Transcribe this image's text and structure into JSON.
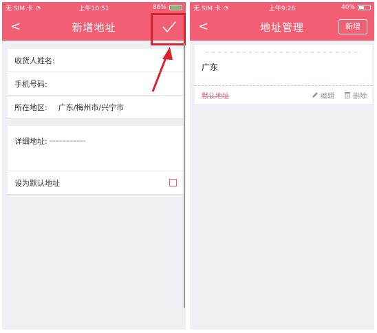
{
  "left": {
    "status": {
      "carrier": "无 SIM 卡",
      "time": "上午10:51",
      "battery": "86%"
    },
    "nav": {
      "back": "<",
      "title": "新增地址"
    },
    "form": {
      "name_label": "收货人姓名:",
      "phone_label": "手机号码:",
      "region_label": "所在地区:",
      "region_value": "广东/梅州市/兴宁市",
      "detail_label": "详细地址:",
      "default_label": "设为默认地址"
    }
  },
  "right": {
    "status": {
      "carrier": "无 SIM 卡",
      "time": "上午9:26",
      "battery": "40%"
    },
    "nav": {
      "back": "<",
      "title": "地址管理",
      "new_button": "新增"
    },
    "card": {
      "region": "广东",
      "default_label": "默认地址",
      "edit_label": "编辑",
      "delete_label": "删除"
    }
  },
  "colors": {
    "accent": "#f25f75",
    "highlight": "#d9232d",
    "background": "#efeff4"
  },
  "icons": [
    "back-icon",
    "check-icon",
    "wifi-icon",
    "battery-icon",
    "pencil-icon",
    "trash-icon",
    "arrow-annotation"
  ]
}
